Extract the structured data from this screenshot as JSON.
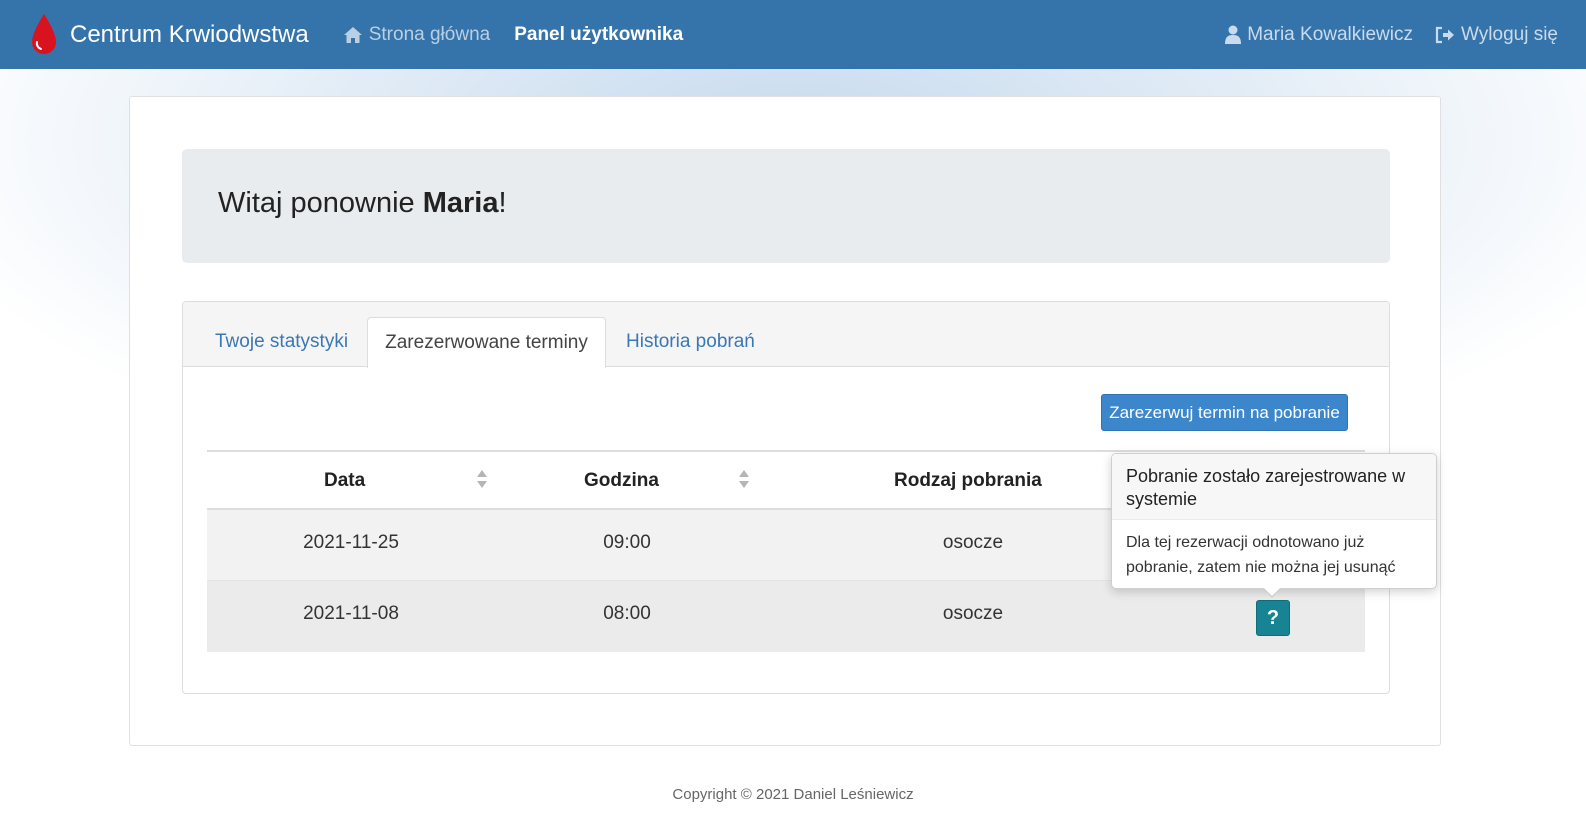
{
  "navbar": {
    "brand": "Centrum Krwiodwstwa",
    "brand_icon": "blood-drop-icon",
    "home_label": "Strona główna",
    "home_icon": "home-icon",
    "panel_label": "Panel użytkownika",
    "user_name": "Maria Kowalkiewicz",
    "user_icon": "user-icon",
    "logout_label": "Wyloguj się",
    "logout_icon": "sign-out-icon",
    "color": "#3573ab"
  },
  "welcome": {
    "prefix": "Witaj ponownie ",
    "name": "Maria",
    "suffix": "!"
  },
  "tabs": [
    {
      "label": "Twoje statystyki",
      "active": false
    },
    {
      "label": "Zarezerwowane terminy",
      "active": true
    },
    {
      "label": "Historia pobrań",
      "active": false
    }
  ],
  "reserve_button": "Zarezerwuj termin na pobranie",
  "table": {
    "headers": [
      "Data",
      "Godzina",
      "Rodzaj pobrania"
    ],
    "rows": [
      {
        "date": "2021-11-25",
        "time": "09:00",
        "type": "osocze"
      },
      {
        "date": "2021-11-08",
        "time": "08:00",
        "type": "osocze"
      }
    ],
    "help_button": "?"
  },
  "popover": {
    "title": "Pobranie zostało zarejestrowane w systemie",
    "body": "Dla tej rezerwacji odnotowano już pobranie, zatem nie można jej usunąć"
  },
  "footer": "Copyright © 2021 Daniel Leśniewicz"
}
